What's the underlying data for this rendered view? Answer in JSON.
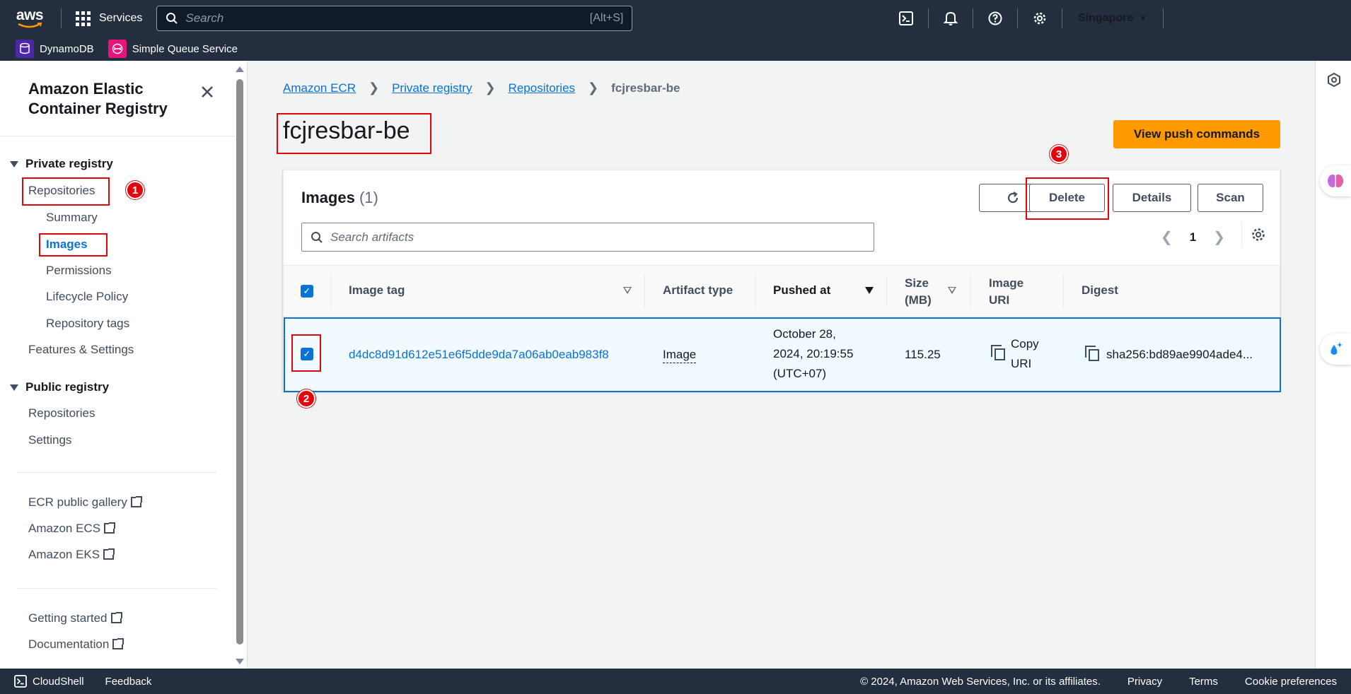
{
  "topnav": {
    "logo": "aws",
    "services_label": "Services",
    "search_placeholder": "Search",
    "search_shortcut": "[Alt+S]",
    "region": "Singapore"
  },
  "favorites": [
    {
      "label": "DynamoDB",
      "icon": "dynamodb-icon",
      "color": "#4d27aa"
    },
    {
      "label": "Simple Queue Service",
      "icon": "sqs-icon",
      "color": "#e7157b"
    }
  ],
  "sidebar": {
    "title": "Amazon Elastic Container Registry",
    "private_registry": "Private registry",
    "repositories": "Repositories",
    "summary": "Summary",
    "images": "Images",
    "permissions": "Permissions",
    "lifecycle_policy": "Lifecycle Policy",
    "repository_tags": "Repository tags",
    "features_settings": "Features & Settings",
    "public_registry": "Public registry",
    "public_repositories": "Repositories",
    "public_settings": "Settings",
    "ecr_public_gallery": "ECR public gallery",
    "amazon_ecs": "Amazon ECS",
    "amazon_eks": "Amazon EKS",
    "getting_started": "Getting started",
    "documentation": "Documentation"
  },
  "breadcrumb": [
    "Amazon ECR",
    "Private registry",
    "Repositories",
    "fcjresbar-be"
  ],
  "page_title": "fcjresbar-be",
  "view_push_commands": "View push commands",
  "panel": {
    "title": "Images",
    "count": "(1)",
    "delete": "Delete",
    "details": "Details",
    "scan": "Scan",
    "search_placeholder": "Search artifacts",
    "page": "1"
  },
  "table": {
    "headers": {
      "image_tag": "Image tag",
      "artifact_type": "Artifact type",
      "pushed_at": "Pushed at",
      "size_line1": "Size",
      "size_line2": "(MB)",
      "image_uri_line1": "Image",
      "image_uri_line2": "URI",
      "digest": "Digest"
    },
    "rows": [
      {
        "image_tag": "d4dc8d91d612e51e6f5dde9da7a06ab0eab983f8",
        "artifact_type": "Image",
        "pushed_at_line1": "October 28,",
        "pushed_at_line2": "2024, 20:19:55",
        "pushed_at_line3": "(UTC+07)",
        "size": "115.25",
        "copy_uri_line1": "Copy",
        "copy_uri_line2": "URI",
        "digest": "sha256:bd89ae9904ade4..."
      }
    ]
  },
  "annotations": [
    "1",
    "2",
    "3"
  ],
  "footer": {
    "cloudshell": "CloudShell",
    "feedback": "Feedback",
    "copyright": "© 2024, Amazon Web Services, Inc. or its affiliates.",
    "privacy": "Privacy",
    "terms": "Terms",
    "cookie": "Cookie preferences"
  },
  "colors": {
    "nav_bg": "#232f3e",
    "link": "#0972d3",
    "primary_button": "#ff9900",
    "annotation_red": "#e3050b"
  }
}
